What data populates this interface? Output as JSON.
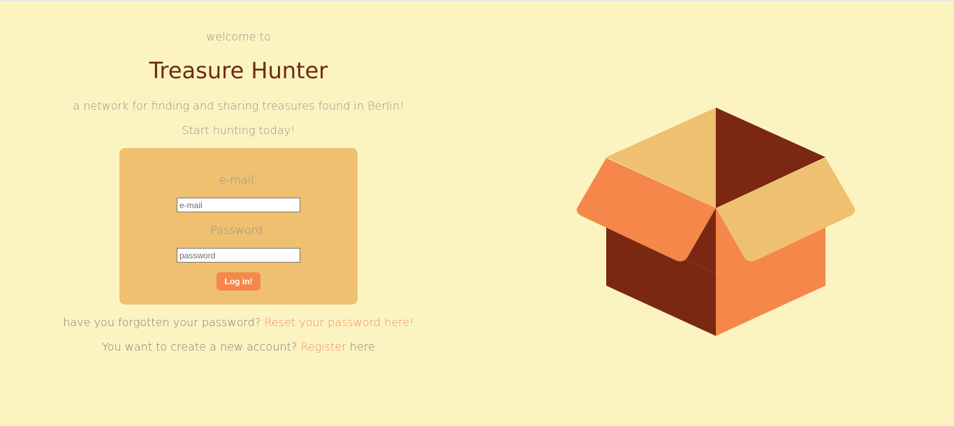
{
  "intro": {
    "welcome": "welcome to",
    "title": "Treasure Hunter",
    "subtitle": "a network for finding and sharing treasures found in Berlin!",
    "tagline": "Start hunting today!"
  },
  "login_form": {
    "email_label": "e-mail:",
    "email_placeholder": "e-mail",
    "email_value": "",
    "password_label": "Password:",
    "password_placeholder": "password",
    "password_value": "",
    "submit_label": "Log in!"
  },
  "footer": {
    "forgot_prefix": "have you forgotten your password?",
    "forgot_link": "Reset your password here!",
    "register_prefix": "You want to create a new account?",
    "register_link": "Register",
    "register_suffix": "here"
  },
  "illustration": {
    "icon": "open-box-icon"
  },
  "colors": {
    "background": "#fcf4c0",
    "card": "#eec06f",
    "title": "#6e2b12",
    "button": "#f5874a",
    "link": "#f08a5d",
    "box_dark": "#7a2811",
    "box_orange": "#f5874a",
    "box_tan": "#eec06f"
  }
}
